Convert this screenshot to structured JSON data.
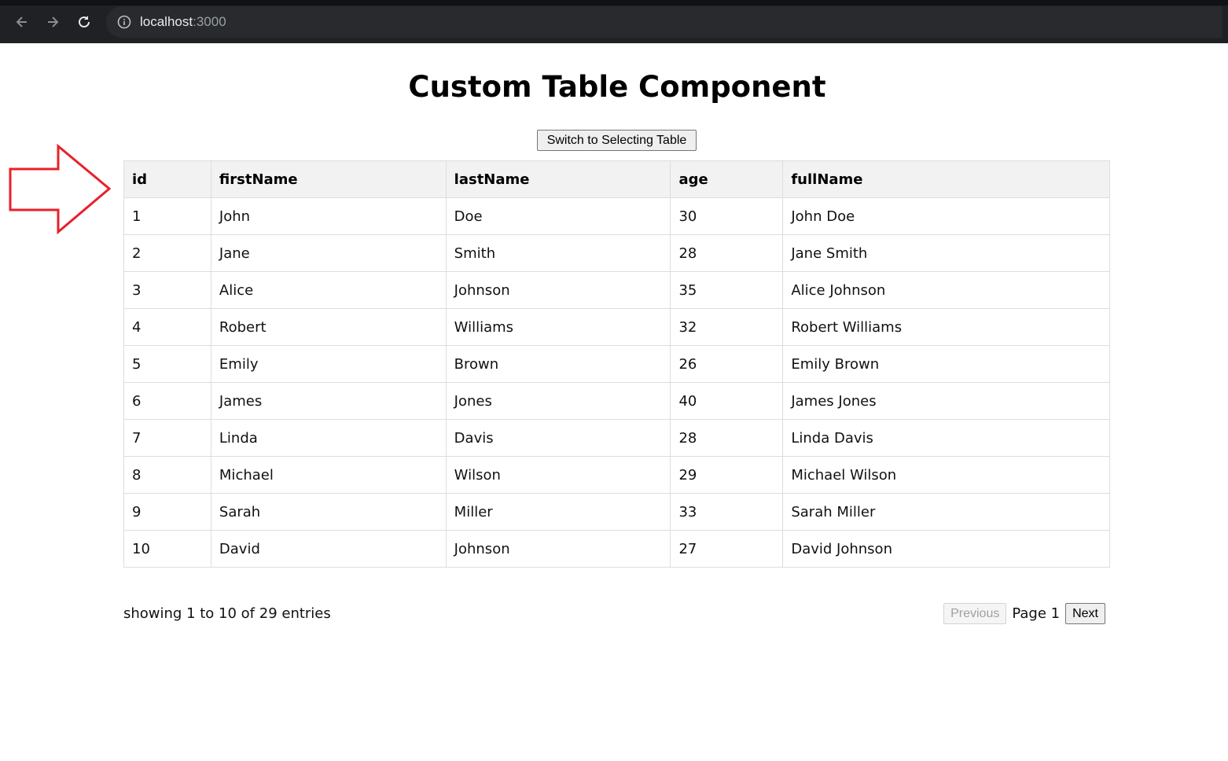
{
  "browser": {
    "url_host": "localhost",
    "url_port": ":3000"
  },
  "page": {
    "title": "Custom Table Component",
    "switch_button_label": "Switch to Selecting Table"
  },
  "table": {
    "columns": [
      "id",
      "firstName",
      "lastName",
      "age",
      "fullName"
    ],
    "rows": [
      [
        "1",
        "John",
        "Doe",
        "30",
        "John Doe"
      ],
      [
        "2",
        "Jane",
        "Smith",
        "28",
        "Jane Smith"
      ],
      [
        "3",
        "Alice",
        "Johnson",
        "35",
        "Alice Johnson"
      ],
      [
        "4",
        "Robert",
        "Williams",
        "32",
        "Robert Williams"
      ],
      [
        "5",
        "Emily",
        "Brown",
        "26",
        "Emily Brown"
      ],
      [
        "6",
        "James",
        "Jones",
        "40",
        "James Jones"
      ],
      [
        "7",
        "Linda",
        "Davis",
        "28",
        "Linda Davis"
      ],
      [
        "8",
        "Michael",
        "Wilson",
        "29",
        "Michael Wilson"
      ],
      [
        "9",
        "Sarah",
        "Miller",
        "33",
        "Sarah Miller"
      ],
      [
        "10",
        "David",
        "Johnson",
        "27",
        "David Johnson"
      ]
    ]
  },
  "footer": {
    "entries_text": "showing 1 to 10 of 29 entries",
    "previous_label": "Previous",
    "page_label": "Page 1",
    "next_label": "Next"
  },
  "colors": {
    "annotation_arrow": "#e8202a",
    "browser_chrome": "#202124",
    "header_bg": "#f2f2f2"
  }
}
